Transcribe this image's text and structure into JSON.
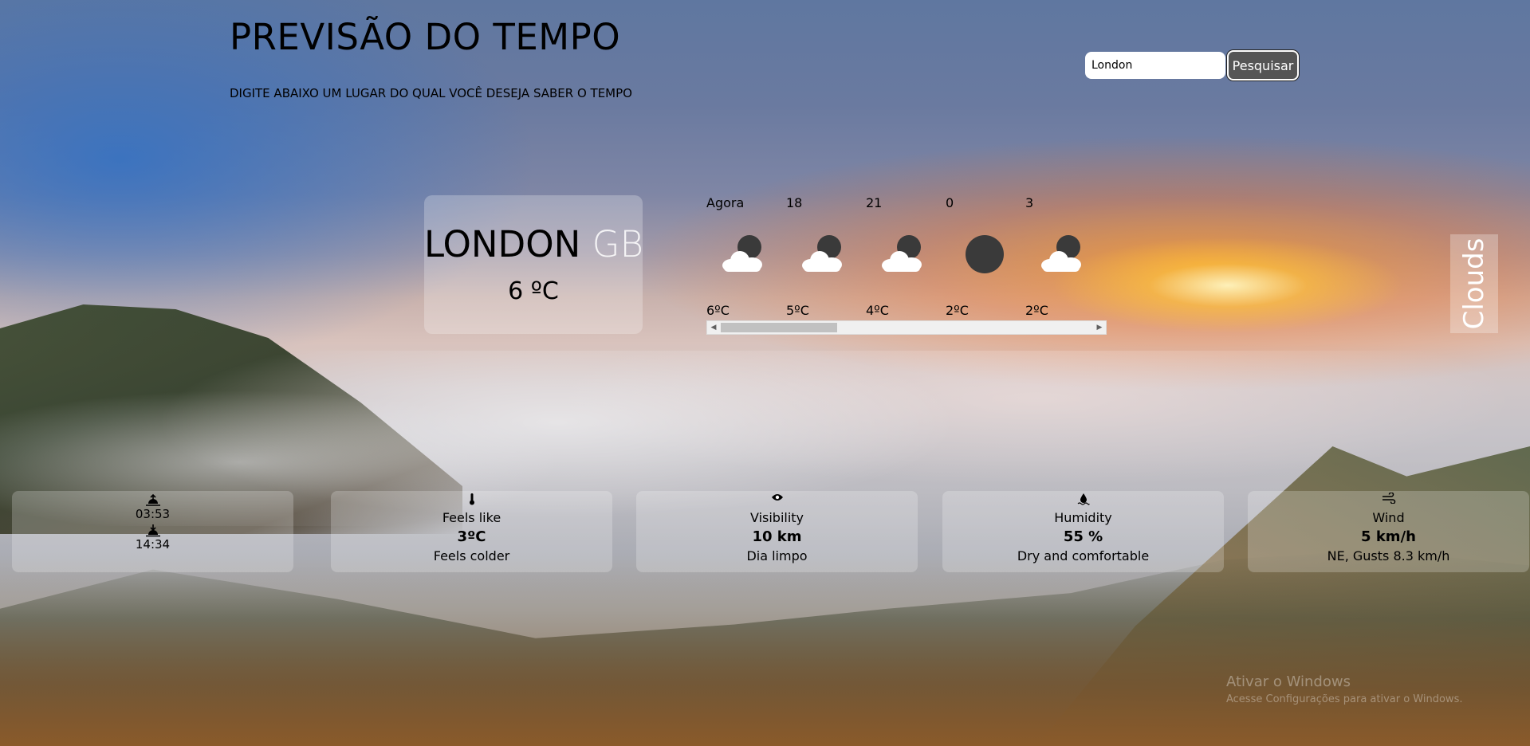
{
  "header": {
    "title": "PREVISÃO DO TEMPO",
    "subtitle": "DIGITE ABAIXO UM LUGAR DO QUAL VOCÊ DESEJA SABER O TEMPO"
  },
  "search": {
    "value": "London",
    "button_label": "Pesquisar"
  },
  "current": {
    "city": "LONDON",
    "country": "GB",
    "temperature": "6 ºC",
    "condition": "Clouds"
  },
  "forecast": [
    {
      "time": "Agora",
      "icon": "partly-cloudy-icon",
      "temp": "6ºC"
    },
    {
      "time": "18",
      "icon": "partly-cloudy-icon",
      "temp": "5ºC"
    },
    {
      "time": "21",
      "icon": "partly-cloudy-icon",
      "temp": "4ºC"
    },
    {
      "time": "0",
      "icon": "clear-moon-icon",
      "temp": "2ºC"
    },
    {
      "time": "3",
      "icon": "partly-cloudy-icon",
      "temp": "2ºC"
    }
  ],
  "stats": {
    "sun": {
      "sunrise": "03:53",
      "sunset": "14:34"
    },
    "feels_like": {
      "title": "Feels like",
      "value": "3ºC",
      "desc": "Feels colder"
    },
    "visibility": {
      "title": "Visibility",
      "value": "10 km",
      "desc": "Dia limpo"
    },
    "humidity": {
      "title": "Humidity",
      "value": "55 %",
      "desc": "Dry and comfortable"
    },
    "wind": {
      "title": "Wind",
      "value": "5 km/h",
      "desc": "NE, Gusts 8.3 km/h"
    }
  },
  "windows_watermark": {
    "title": "Ativar o Windows",
    "subtitle": "Acesse Configurações para ativar o Windows."
  }
}
